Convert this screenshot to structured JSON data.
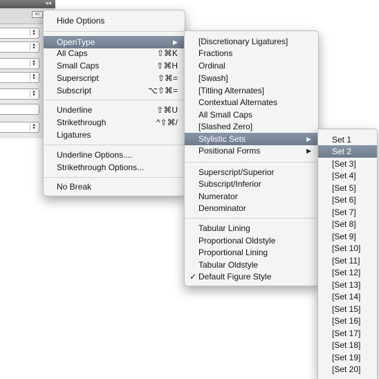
{
  "background": {
    "collapse_glyph": "◂◂",
    "panel_menu_icon": "▾≡"
  },
  "menu": {
    "hide_options": "Hide Options",
    "opentype": "OpenType",
    "all_caps": {
      "label": "All Caps",
      "shortcut": "⇧⌘K"
    },
    "small_caps": {
      "label": "Small Caps",
      "shortcut": "⇧⌘H"
    },
    "superscript": {
      "label": "Superscript",
      "shortcut": "⇧⌘="
    },
    "subscript": {
      "label": "Subscript",
      "shortcut": "⌥⇧⌘="
    },
    "underline": {
      "label": "Underline",
      "shortcut": "⇧⌘U"
    },
    "strikethrough": {
      "label": "Strikethrough",
      "shortcut": "^⇧⌘/"
    },
    "ligatures": "Ligatures",
    "underline_options": "Underline Options....",
    "strikethrough_options": "Strikethrough Options...",
    "no_break": "No Break"
  },
  "opentype_menu": {
    "discretionary_ligatures": "[Discretionary Ligatures]",
    "fractions": "Fractions",
    "ordinal": "Ordinal",
    "swash": "[Swash]",
    "titling_alternates": "[Titling Alternates]",
    "contextual_alternates": "Contextual Alternates",
    "all_small_caps": "All Small Caps",
    "slashed_zero": "[Slashed Zero]",
    "stylistic_sets": "Stylistic Sets",
    "positional_forms": "Positional Forms",
    "superscript_superior": "Superscript/Superior",
    "subscript_inferior": "Subscript/Inferior",
    "numerator": "Numerator",
    "denominator": "Denominator",
    "tabular_lining": "Tabular Lining",
    "proportional_oldstyle": "Proportional Oldstyle",
    "proportional_lining": "Proportional Lining",
    "tabular_oldstyle": "Tabular Oldstyle",
    "default_figure_style": "Default Figure Style",
    "checkmark": "✓"
  },
  "stylistic_sets": [
    "Set 1",
    "Set 2",
    "[Set 3]",
    "[Set 4]",
    "[Set 5]",
    "[Set 6]",
    "[Set 7]",
    "[Set 8]",
    "[Set 9]",
    "[Set 10]",
    "[Set 11]",
    "[Set 12]",
    "[Set 13]",
    "[Set 14]",
    "[Set 15]",
    "[Set 16]",
    "[Set 17]",
    "[Set 18]",
    "[Set 19]",
    "[Set 20]"
  ],
  "submenu_arrow": "▶",
  "colors": {
    "highlight": "#7d8a99",
    "menu_bg": "#f4f4f4"
  }
}
